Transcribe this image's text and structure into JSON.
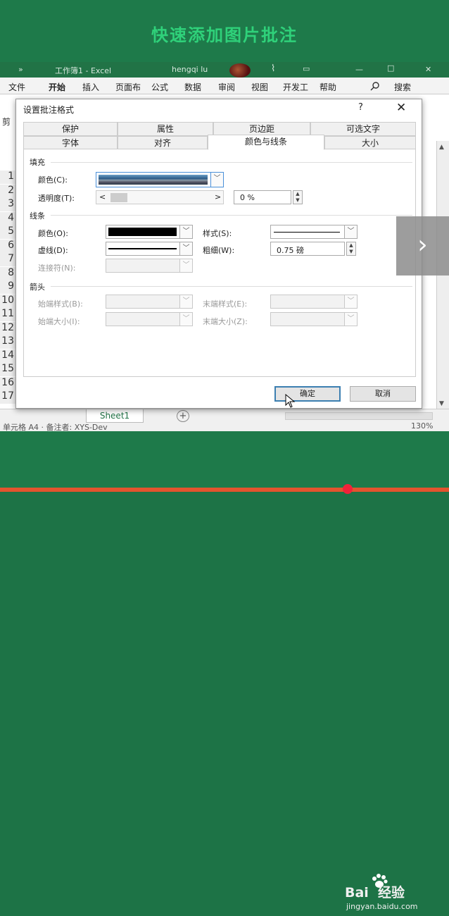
{
  "banner": {
    "title": "快速添加图片批注"
  },
  "titlebar": {
    "chevron": "»",
    "doc_title": "工作簿1 - Excel",
    "user": "hengqi lu",
    "brush_icon": "⌇",
    "box_icon": "▭",
    "min_icon": "—",
    "max_icon": "□",
    "close_icon": "✕"
  },
  "ribbon": {
    "tabs": [
      "文件",
      "开始",
      "插入",
      "页面布",
      "公式",
      "数据",
      "审阅",
      "视图",
      "开发工",
      "帮助"
    ],
    "search_label": "搜索",
    "clipboard": "剪"
  },
  "sheet": {
    "rows": [
      "1",
      "2",
      "3",
      "4",
      "5",
      "6",
      "7",
      "8",
      "9",
      "10",
      "11",
      "12",
      "13",
      "14",
      "15",
      "16",
      "17"
    ],
    "tab": "Sheet1",
    "add_sheet": "+"
  },
  "statusbar": {
    "text": "单元格 A4 · 备注者: XYS-Dev",
    "zoom": "130%"
  },
  "dialog": {
    "title": "设置批注格式",
    "help": "?",
    "close": "✕",
    "tabs_row1": [
      "保护",
      "属性",
      "页边距",
      "可选文字"
    ],
    "tabs_row2": [
      "字体",
      "对齐",
      "颜色与线条",
      "大小"
    ],
    "fill_section": "填充",
    "fill_color_label": "颜色(C):",
    "transparency_label": "透明度(T):",
    "transparency_value": "0 %",
    "line_section": "线条",
    "line_color_label": "颜色(O):",
    "dash_label": "虚线(D):",
    "connector_label": "连接符(N):",
    "style_label": "样式(S):",
    "weight_label": "粗细(W):",
    "weight_value": "0.75 磅",
    "arrows_section": "箭头",
    "begin_style_label": "始端样式(B):",
    "begin_size_label": "始端大小(I):",
    "end_style_label": "末端样式(E):",
    "end_size_label": "末端大小(Z):",
    "ok_label": "确定",
    "cancel_label": "取消",
    "line_color": "#000000"
  },
  "nav": {
    "next": "›"
  },
  "watermark": {
    "brand": "Bai  经验",
    "site": "jingyan.baidu.com"
  }
}
